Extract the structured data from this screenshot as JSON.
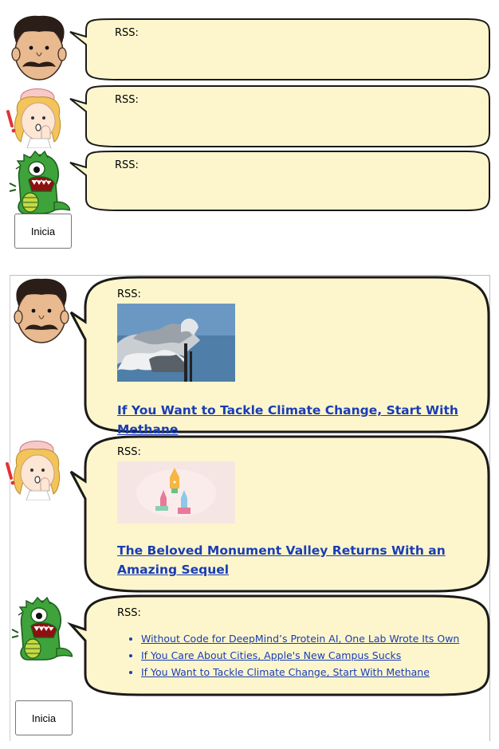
{
  "rss_label": "RSS:",
  "start_button_label": "Inicia",
  "panel_top": {
    "bubbles": [
      {
        "avatar": "man-with-mustache-icon"
      },
      {
        "avatar": "nurse-icon"
      },
      {
        "avatar": "green-dinosaur-icon"
      }
    ]
  },
  "panel_bottom": {
    "bubble1": {
      "avatar": "man-with-mustache-icon",
      "image": "smokestacks-photo",
      "title": "If You Want to Tackle Climate Change, Start With Methane"
    },
    "bubble2": {
      "avatar": "nurse-icon",
      "image": "monument-valley-game-art",
      "title": "The Beloved Monument Valley Returns With an Amazing Sequel"
    },
    "bubble3": {
      "avatar": "green-dinosaur-icon",
      "links": [
        "Without Code for DeepMind’s Protein AI, One Lab Wrote Its Own",
        "If You Care About Cities, Apple's New Campus Sucks",
        "If You Want to Tackle Climate Change, Start With Methane"
      ]
    }
  },
  "colors": {
    "bubble_fill": "#fdf6cc",
    "bubble_stroke": "#1a1a1a",
    "link": "#1a3db5"
  }
}
